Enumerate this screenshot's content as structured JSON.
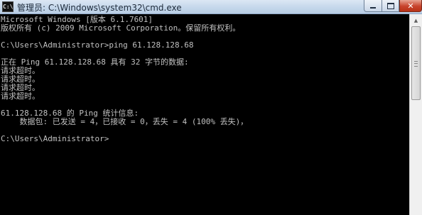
{
  "window": {
    "title": "管理员: C:\\Windows\\system32\\cmd.exe",
    "icon": "cmd-icon",
    "controls": {
      "minimize": "minimize-icon",
      "maximize": "maximize-icon",
      "close": "close-icon"
    }
  },
  "console": {
    "lines": [
      "Microsoft Windows [版本 6.1.7601]",
      "版权所有 (c) 2009 Microsoft Corporation。保留所有权利。",
      "",
      "C:\\Users\\Administrator>ping 61.128.128.68",
      "",
      "正在 Ping 61.128.128.68 具有 32 字节的数据:",
      "请求超时。",
      "请求超时。",
      "请求超时。",
      "请求超时。",
      "",
      "61.128.128.68 的 Ping 统计信息:",
      "    数据包: 已发送 = 4，已接收 = 0，丢失 = 4 (100% 丢失)，",
      "",
      "C:\\Users\\Administrator>"
    ]
  },
  "colors": {
    "console_bg": "#000000",
    "console_fg": "#c0c0c0",
    "close_button": "#c7432c"
  }
}
